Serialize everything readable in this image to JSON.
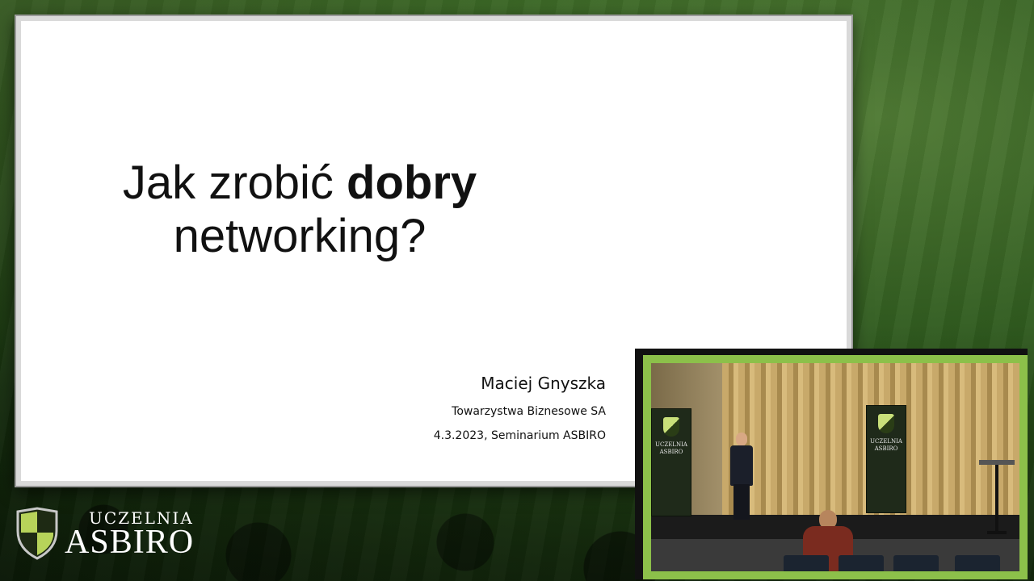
{
  "slide": {
    "title_normal": "Jak zrobić ",
    "title_bold": "dobry",
    "title_line2": "networking?",
    "presenter_name": "Maciej Gnyszka",
    "presenter_company": "Towarzystwa Biznesowe SA",
    "presenter_event": "4.3.2023, Seminarium ASBIRO"
  },
  "logo": {
    "top_text": "UCZELNIA",
    "main_text": "ASBIRO"
  },
  "pip": {
    "banner_left_text": "UCZELNIA ASBIRO",
    "banner_right_text": "UCZELNIA ASBIRO"
  },
  "colors": {
    "accent_green": "#8cc04a",
    "background_green": "#2f5a1e"
  }
}
